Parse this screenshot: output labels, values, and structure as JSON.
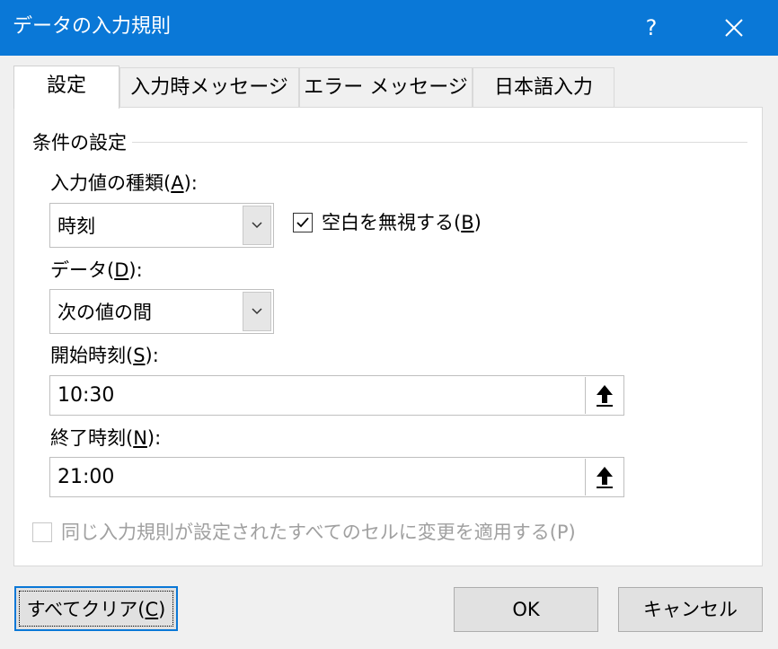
{
  "window": {
    "title": "データの入力規則",
    "help_label": "?"
  },
  "tabs": [
    {
      "label": "設定",
      "active": true
    },
    {
      "label": "入力時メッセージ",
      "active": false
    },
    {
      "label": "エラー メッセージ",
      "active": false
    },
    {
      "label": "日本語入力",
      "active": false
    }
  ],
  "settings": {
    "group_label": "条件の設定",
    "allow": {
      "label_prefix": "入力値の種類(",
      "label_key": "A",
      "label_suffix": "):",
      "value": "時刻"
    },
    "ignore_blank": {
      "label_prefix": "空白を無視する(",
      "label_key": "B",
      "label_suffix": ")",
      "checked": true
    },
    "data": {
      "label_prefix": "データ(",
      "label_key": "D",
      "label_suffix": "):",
      "value": "次の値の間"
    },
    "start_time": {
      "label_prefix": "開始時刻(",
      "label_key": "S",
      "label_suffix": "):",
      "value": "10:30"
    },
    "end_time": {
      "label_prefix": "終了時刻(",
      "label_key": "N",
      "label_suffix": "):",
      "value": "21:00"
    },
    "apply_all": {
      "label": "同じ入力規則が設定されたすべてのセルに変更を適用する(P)",
      "checked": false,
      "disabled": true
    }
  },
  "buttons": {
    "clear_all_prefix": "すべてクリア(",
    "clear_all_key": "C",
    "clear_all_suffix": ")",
    "ok": "OK",
    "cancel": "キャンセル"
  },
  "colors": {
    "titlebar": "#0a78d7",
    "dialog_bg": "#f0f0f0",
    "default_button_border": "#0a78d7"
  }
}
